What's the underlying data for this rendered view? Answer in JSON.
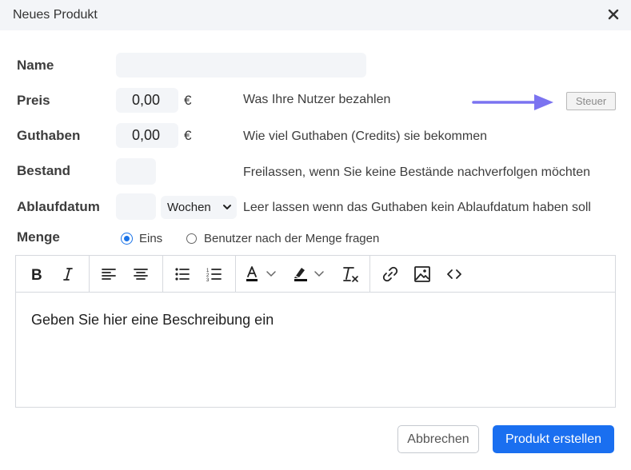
{
  "dialog": {
    "title": "Neues Produkt",
    "close_icon": "close-icon"
  },
  "form": {
    "name": {
      "label": "Name",
      "value": ""
    },
    "preis": {
      "label": "Preis",
      "value": "0,00",
      "currency": "€",
      "help": "Was Ihre Nutzer bezahlen",
      "tax_button": "Steuer"
    },
    "guthaben": {
      "label": "Guthaben",
      "value": "0,00",
      "currency": "€",
      "help": "Wie viel Guthaben (Credits) sie bekommen"
    },
    "bestand": {
      "label": "Bestand",
      "value": "",
      "help": "Freilassen, wenn Sie keine Bestände nachverfolgen möchten"
    },
    "ablaufdatum": {
      "label": "Ablaufdatum",
      "value": "",
      "unit": "Wochen",
      "help": "Leer lassen wenn das Guthaben kein Ablaufdatum haben soll"
    },
    "menge": {
      "label": "Menge",
      "options": [
        "Eins",
        "Benutzer nach der Menge fragen"
      ],
      "selected": "Eins"
    }
  },
  "editor": {
    "toolbar_icons": [
      "bold-icon",
      "italic-icon",
      "align-left-icon",
      "align-center-icon",
      "bullet-list-icon",
      "numbered-list-icon",
      "text-color-icon",
      "highlight-icon",
      "clear-format-icon",
      "link-icon",
      "image-icon",
      "code-icon"
    ],
    "placeholder": "Geben Sie hier eine Beschreibung ein"
  },
  "actions": {
    "cancel": "Abbrechen",
    "submit": "Produkt erstellen"
  },
  "colors": {
    "accent": "#1a6ff0",
    "arrow": "#7b73f0",
    "field_bg": "#f3f5f8"
  }
}
